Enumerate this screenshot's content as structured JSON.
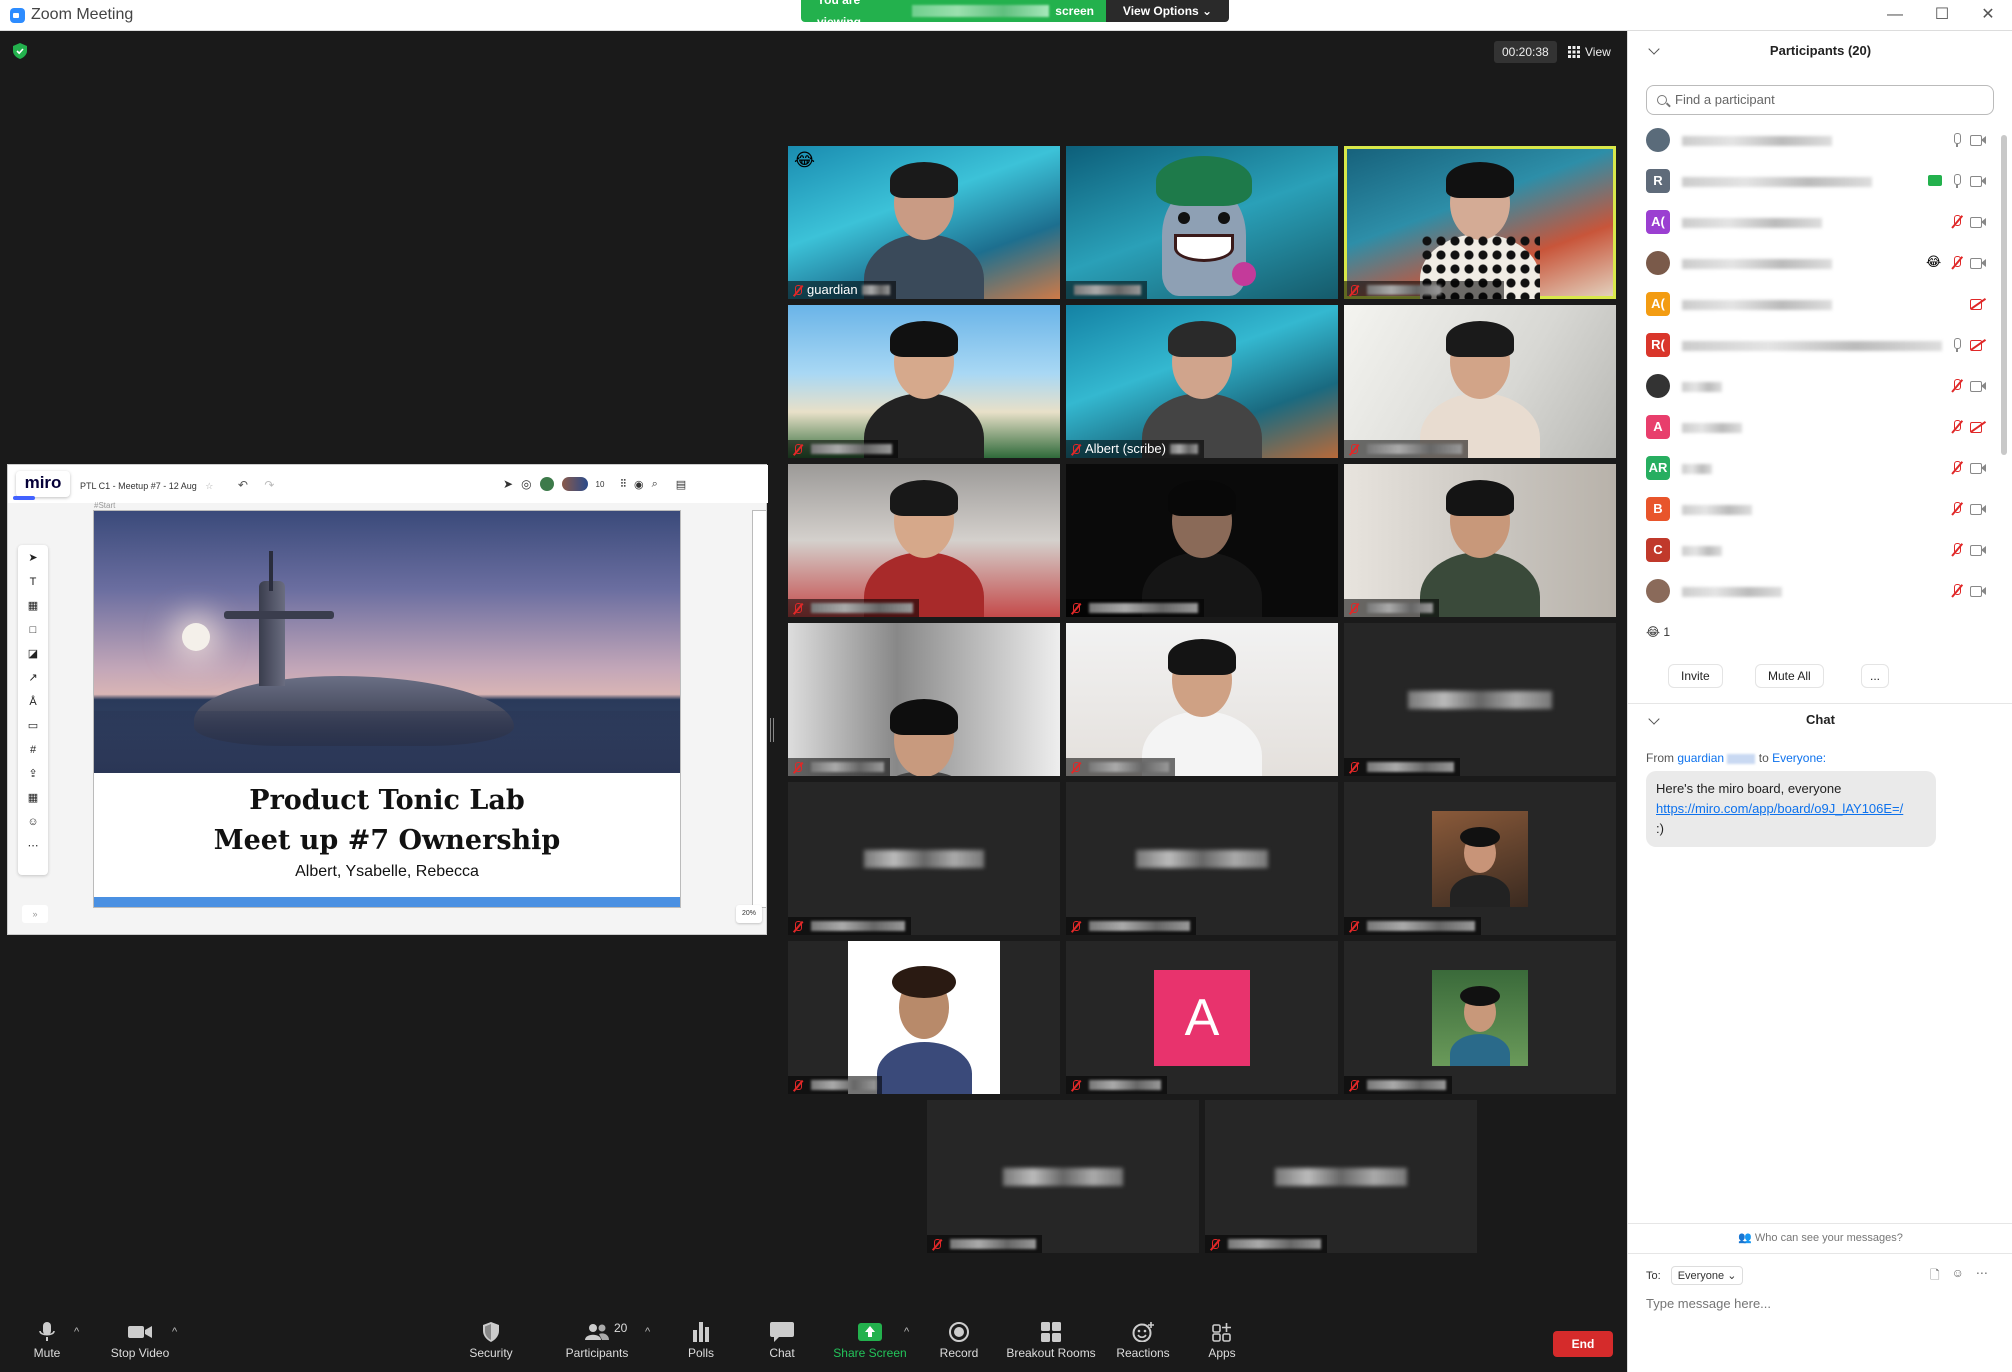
{
  "window": {
    "title": "Zoom Meeting",
    "minimize": "—",
    "maximize": "☐",
    "close": "✕"
  },
  "banner": {
    "prefix": "You are viewing",
    "suffix": "screen",
    "view_options": "View Options ⌄"
  },
  "meeting": {
    "timer": "00:20:38",
    "view_label": "View"
  },
  "miro": {
    "logo": "miro",
    "board_title": "PTL C1 - Meetup #7 - 12 Aug",
    "frame_label": "#Start",
    "collaborator_count": "10",
    "zoom": "20%",
    "slide_title_line1": "Product Tonic Lab",
    "slide_title_line2": "Meet up #7 Ownership",
    "slide_authors": "Albert, Ysabelle, Rebecca"
  },
  "tiles": [
    {
      "name": "guardian"
    },
    {
      "name": ""
    },
    {
      "name": ""
    },
    {
      "name": ""
    },
    {
      "name": "Albert (scribe)"
    },
    {
      "name": ""
    },
    {
      "name": ""
    },
    {
      "name": ""
    },
    {
      "name": ""
    },
    {
      "name": ""
    },
    {
      "name": ""
    },
    {
      "name": ""
    },
    {
      "name": ""
    },
    {
      "name": ""
    },
    {
      "name": ""
    },
    {
      "name": ""
    },
    {
      "name": "",
      "initial": "A"
    },
    {
      "name": ""
    },
    {
      "name": ""
    },
    {
      "name": ""
    }
  ],
  "toolbar": {
    "mute": "Mute",
    "stop_video": "Stop Video",
    "security": "Security",
    "participants": "Participants",
    "participants_count": "20",
    "polls": "Polls",
    "chat": "Chat",
    "share_screen": "Share Screen",
    "record": "Record",
    "breakout_rooms": "Breakout Rooms",
    "reactions": "Reactions",
    "apps": "Apps",
    "end": "End"
  },
  "participants_panel": {
    "title": "Participants (20)",
    "search_placeholder": "Find a participant",
    "rows": [
      {
        "initial": "",
        "color": "#5a6b7a"
      },
      {
        "initial": "R",
        "color": "#5f6b7a"
      },
      {
        "initial": "A(",
        "color": "#9b3fd1"
      },
      {
        "initial": "",
        "color": "#7a5a4a"
      },
      {
        "initial": "A(",
        "color": "#f39c12"
      },
      {
        "initial": "R(",
        "color": "#d9362b"
      },
      {
        "initial": "",
        "color": "#333333"
      },
      {
        "initial": "A",
        "color": "#e83e6c"
      },
      {
        "initial": "AR",
        "color": "#27ae60"
      },
      {
        "initial": "B",
        "color": "#e8552b"
      },
      {
        "initial": "C",
        "color": "#c0392b"
      },
      {
        "initial": "",
        "color": "#8a6a5a"
      }
    ],
    "reaction_count": "1",
    "invite": "Invite",
    "mute_all": "Mute All",
    "more": "..."
  },
  "chat": {
    "title": "Chat",
    "from_label": "From",
    "from_name": "guardian",
    "to_label": "to",
    "to_name": "Everyone:",
    "message_text": "Here's the miro board, everyone",
    "message_url": "https://miro.com/app/board/o9J_lAY106E=/",
    "message_tail": ":)",
    "who_can_see": "Who can see your messages?",
    "to_prefix": "To:",
    "to_value": "Everyone ⌄",
    "input_placeholder": "Type message here..."
  }
}
